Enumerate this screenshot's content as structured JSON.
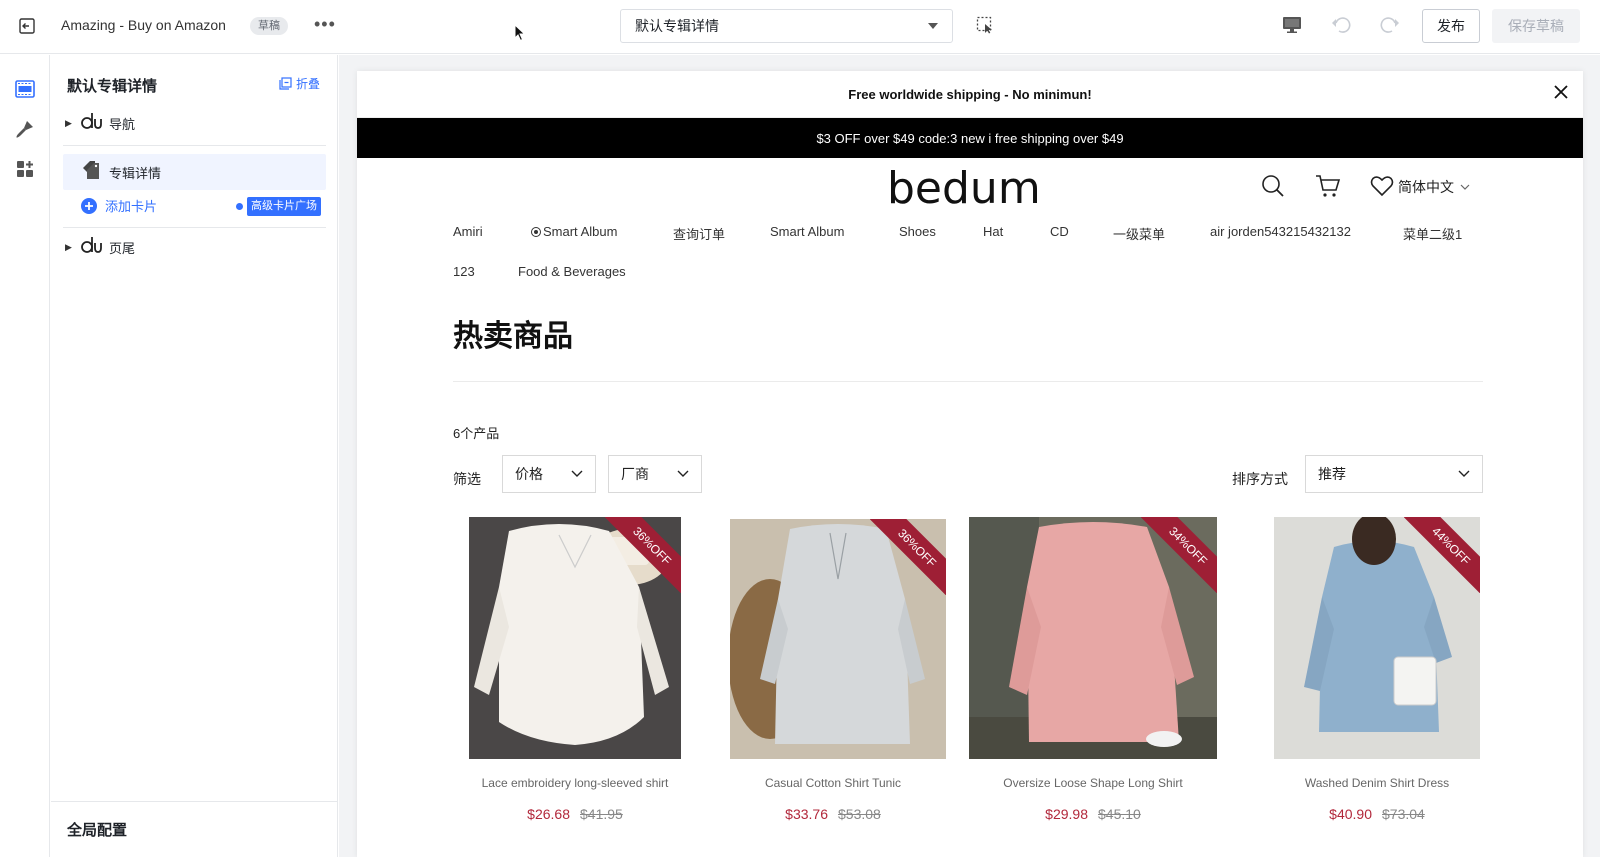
{
  "topbar": {
    "store_name": "Amazing - Buy on Amazon",
    "status_badge": "草稿",
    "more_label": "•••",
    "page_selector": "默认专辑详情",
    "publish_label": "发布",
    "save_draft_label": "保存草稿",
    "icons": [
      "exit-icon",
      "more-icon",
      "chevron-down-icon",
      "element-select-icon",
      "desktop-icon",
      "undo-icon",
      "redo-icon"
    ]
  },
  "rail": {
    "icons": [
      "sections-icon",
      "theme-brush-icon",
      "apps-icon"
    ]
  },
  "panel": {
    "title": "默认专辑详情",
    "collapse_label": "折叠",
    "tree": [
      {
        "label": "导航",
        "icon": "section-du-icon"
      },
      {
        "label": "专辑详情",
        "icon": "collection-tag-icon"
      },
      {
        "label": "页尾",
        "icon": "section-du-icon"
      }
    ],
    "add_card_label": "添加卡片",
    "card_market_label": "高级卡片广场",
    "global_config_label": "全局配置"
  },
  "preview": {
    "announcement": "Free worldwide shipping - No minimun!",
    "promo": "$3 OFF over $49 code:3 new i free shipping over $49",
    "logo_text": "bedum",
    "language": "简体中文",
    "menu": [
      "Amiri",
      "Smart Album",
      "查询订单",
      "Smart Album",
      "Shoes",
      "Hat",
      "CD",
      "一级菜单",
      "air jorden543215432132",
      "菜单二级1",
      "123",
      "Food & Beverages"
    ],
    "collection_title": "热卖商品",
    "product_count": "6个产品",
    "filter_label": "筛选",
    "filter_price": "价格",
    "filter_vendor": "厂商",
    "sort_label": "排序方式",
    "sort_value": "推荐",
    "products": [
      {
        "title": "Lace embroidery long-sleeved shirt",
        "price": "$26.68",
        "compare": "$41.95",
        "badge": "36%OFF"
      },
      {
        "title": "Casual Cotton Shirt Tunic",
        "price": "$33.76",
        "compare": "$53.08",
        "badge": "36%OFF"
      },
      {
        "title": "Oversize Loose Shape Long Shirt",
        "price": "$29.98",
        "compare": "$45.10",
        "badge": "34%OFF"
      },
      {
        "title": "Washed Denim Shirt Dress",
        "price": "$40.90",
        "compare": "$73.04",
        "badge": "44%OFF"
      }
    ]
  },
  "colors": {
    "accent": "#3370ff",
    "sale_ribbon": "#9e1f35",
    "price": "#b2283b",
    "promo_bar": "#000000"
  }
}
